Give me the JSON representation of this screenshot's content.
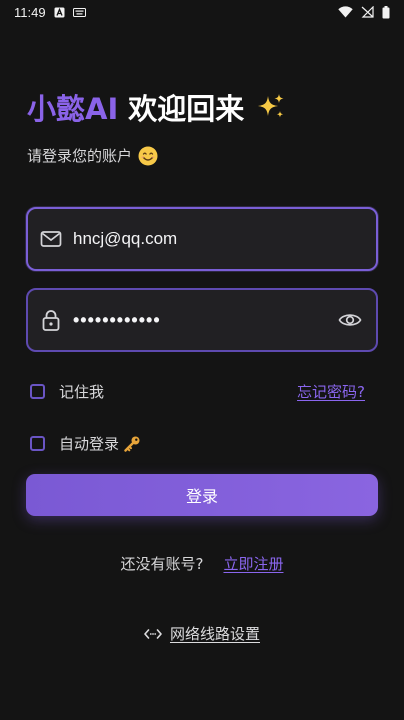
{
  "status_bar": {
    "time": "11:49",
    "icons": [
      "notification-a-icon",
      "keyboard-icon",
      "wifi-icon",
      "cellular-off-icon",
      "battery-icon"
    ]
  },
  "header": {
    "brand": "小懿AI",
    "welcome": "欢迎回来",
    "sparkle_icon": "sparkles-icon",
    "subtitle": "请登录您的账户",
    "subtitle_icon": "smiling-face-icon"
  },
  "form": {
    "email": {
      "value": "hncj@qq.com",
      "icon": "mail-icon",
      "focused": true
    },
    "password": {
      "value": "••••••••••••",
      "icon": "lock-icon",
      "toggle_icon": "eye-icon"
    },
    "remember_me": {
      "label": "记住我",
      "checked": false
    },
    "auto_login": {
      "label": "自动登录",
      "checked": false,
      "icon": "key-icon"
    },
    "forgot_password": "忘记密码?",
    "submit_label": "登录"
  },
  "register": {
    "prompt": "还没有账号?",
    "link": "立即注册"
  },
  "network": {
    "icon": "code-arrows-icon",
    "label": "网络线路设置"
  },
  "colors": {
    "background": "#141414",
    "accent": "#8a63e8",
    "field_background": "#212023",
    "field_border": "#7a5fd6",
    "link": "#8a66ee"
  }
}
